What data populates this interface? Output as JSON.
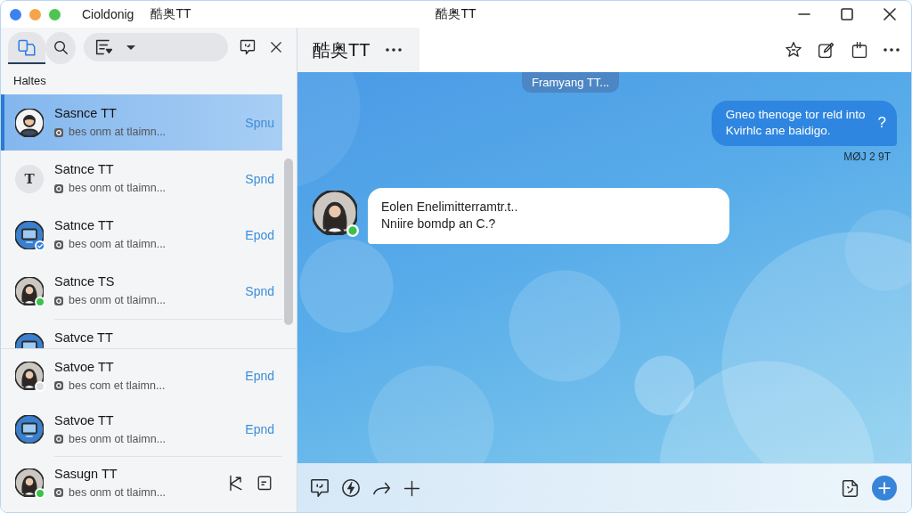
{
  "title_bar": {
    "app_name": "Cioldonig",
    "account_name": "酷奥TT",
    "title": "酷奥TT"
  },
  "sidebar": {
    "tabs": [
      {
        "kind": "chats",
        "selected": true
      },
      {
        "kind": "search",
        "selected": false
      }
    ],
    "section_label": "Haltes",
    "conversation_groups": [
      {
        "kind": "scroll",
        "conversations": [
          {
            "kind": "label",
            "name": "Sasnce TT",
            "preview": "bes onm at tlaimn...",
            "meta": "Spnu",
            "avatar": {
              "kind": "person"
            },
            "selected": true
          },
          {
            "kind": "label",
            "name": "Satnce TT",
            "preview": "bes onm ot tlaimn...",
            "meta": "Spnd",
            "avatar": {
              "kind": "letter",
              "letter": "T"
            },
            "selected": false
          },
          {
            "kind": "label",
            "name": "Satnce TT",
            "preview": "bes oom at tlaimn...",
            "meta": "Epod",
            "avatar": {
              "kind": "device"
            },
            "verified": true,
            "selected": false
          },
          {
            "kind": "label",
            "name": "Satnce TS",
            "preview": "bes onm ot tlaimn...",
            "meta": "Spnd",
            "avatar": {
              "kind": "photo"
            },
            "online": true,
            "selected": false
          },
          {
            "kind": "label",
            "name": "Satvce TT",
            "avatar": {
              "kind": "device"
            },
            "selected": false
          }
        ]
      },
      {
        "kind": "pinned",
        "conversations": [
          {
            "kind": "label",
            "name": "Satvoe TT",
            "preview": "bes com et tlaimn...",
            "meta": "Epnd",
            "avatar": {
              "kind": "photo"
            },
            "online": false,
            "selected": false
          },
          {
            "kind": "label",
            "name": "Satvoe TT",
            "preview": "bes onm ot tlaimn...",
            "meta": "Epnd",
            "avatar": {
              "kind": "device"
            },
            "selected": false
          },
          {
            "kind": "actions",
            "name": "Sasugn TT",
            "preview": "bes onm ot tlaimn...",
            "avatar": {
              "kind": "photo"
            },
            "online": true,
            "selected": false
          }
        ]
      }
    ]
  },
  "chat": {
    "title": "酷奥TT",
    "banner": "Framyang TT...",
    "messages": [
      {
        "kind": "outgoing",
        "lines": [
          "Gneo thenoge tor reld into",
          "Kvirhlc ane baidigo."
        ],
        "mark": "?",
        "time": "MØJ 2 9T"
      },
      {
        "kind": "incoming",
        "lines": [
          "Eolen Enelimitterramtr.t..",
          "Nniire bomdp an C.?"
        ],
        "avatar": {
          "kind": "photo"
        },
        "online": true
      }
    ]
  }
}
